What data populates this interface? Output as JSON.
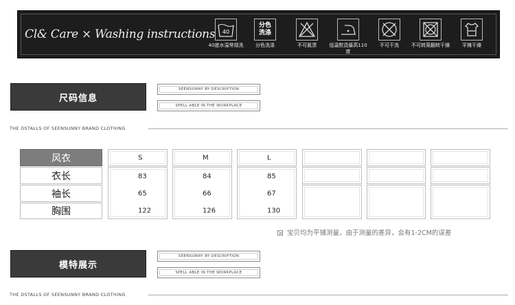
{
  "care": {
    "title": "Cl& Care  × Washing instructions",
    "icons": [
      {
        "name": "wash-40-icon",
        "glyph": "40",
        "caption": "40度水温常规洗"
      },
      {
        "name": "separate-wash-icon",
        "glyph": "分色洗涤",
        "caption": "分色洗涤"
      },
      {
        "name": "no-bleach-icon",
        "glyph": "",
        "caption": "不可氯漂"
      },
      {
        "name": "low-iron-icon",
        "glyph": "",
        "caption": "低温熨烫最高110度"
      },
      {
        "name": "no-dry-clean-icon",
        "glyph": "",
        "caption": "不可干洗"
      },
      {
        "name": "no-tumble-dry-icon",
        "glyph": "",
        "caption": "不可转笼翻转干燥"
      },
      {
        "name": "flat-dry-icon",
        "glyph": "",
        "caption": "平摊干燥"
      }
    ]
  },
  "sections": [
    {
      "title": "尺码信息",
      "desc1": "SEENSUNNY BY DESCRIPTION",
      "desc2": "SPELL ABLE IN THE WORKPLACE",
      "divider": "THE DSTALLS OF SEENSUNNY BRAND CLOTHING"
    },
    {
      "title": "模特展示",
      "desc1": "SEENSUNNY BY DESCRIPTION",
      "desc2": "SPELL ABLE IN THE WORKPLACE",
      "divider": "THE DSTALLS OF SEENSUNNY BRAND CLOTHING"
    }
  ],
  "size_table": {
    "header": "风衣",
    "sizes": [
      "S",
      "M",
      "L",
      "",
      "",
      "",
      ""
    ],
    "rows": [
      {
        "label": "衣长",
        "values": [
          "83",
          "84",
          "85",
          "",
          "",
          "",
          ""
        ]
      },
      {
        "label": "袖长",
        "values": [
          "65",
          "66",
          "67",
          "",
          "",
          "",
          ""
        ]
      },
      {
        "label": "胸围",
        "values": [
          "122",
          "126",
          "130",
          "",
          "",
          "",
          ""
        ]
      }
    ]
  },
  "note": "宝贝均为平铺测量，由于测量的差异，会有1-2CM的误差"
}
